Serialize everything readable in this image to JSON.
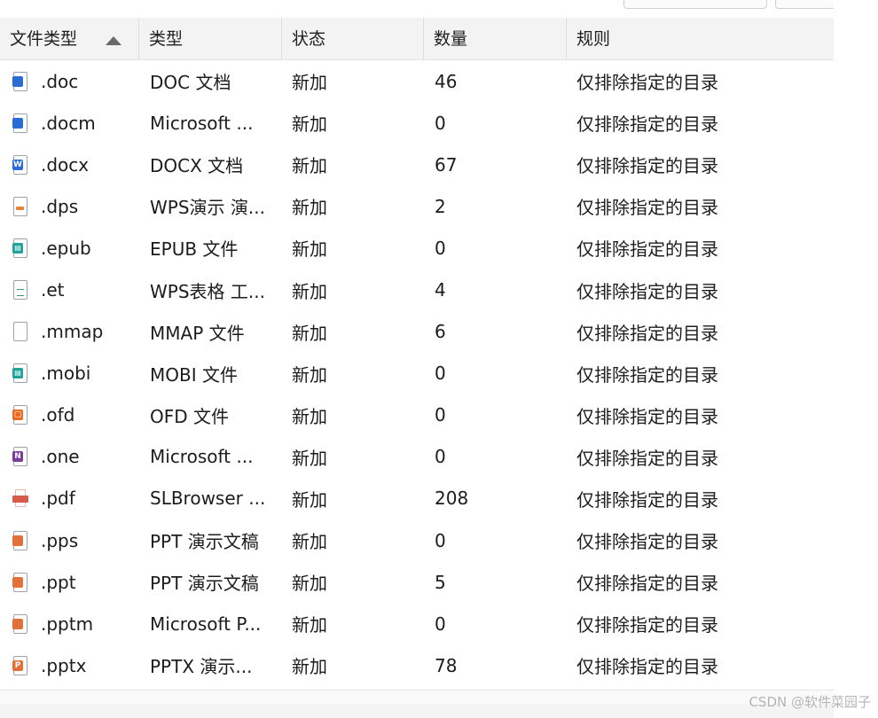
{
  "table": {
    "columns": [
      "文件类型",
      "类型",
      "状态",
      "数量",
      "规则"
    ],
    "sort_column": 0,
    "rows": [
      {
        "ext": ".doc",
        "type": "DOC 文档",
        "status": "新加",
        "count": "46",
        "rule": "仅排除指定的目录",
        "icon": "word-doc-icon",
        "color": "#2b6cd4"
      },
      {
        "ext": ".docm",
        "type": "Microsoft ...",
        "status": "新加",
        "count": "0",
        "rule": "仅排除指定的目录",
        "icon": "word-docm-icon",
        "color": "#2b6cd4"
      },
      {
        "ext": ".docx",
        "type": "DOCX 文档",
        "status": "新加",
        "count": "67",
        "rule": "仅排除指定的目录",
        "icon": "word-docx-icon",
        "color": "#2b6cd4"
      },
      {
        "ext": ".dps",
        "type": "WPS演示 演...",
        "status": "新加",
        "count": "2",
        "rule": "仅排除指定的目录",
        "icon": "wps-dps-icon",
        "color": "#e6843a"
      },
      {
        "ext": ".epub",
        "type": "EPUB 文件",
        "status": "新加",
        "count": "0",
        "rule": "仅排除指定的目录",
        "icon": "epub-book-icon",
        "color": "#1fa39a"
      },
      {
        "ext": ".et",
        "type": "WPS表格 工...",
        "status": "新加",
        "count": "4",
        "rule": "仅排除指定的目录",
        "icon": "wps-et-icon",
        "color": "#3c9a6a"
      },
      {
        "ext": ".mmap",
        "type": "MMAP 文件",
        "status": "新加",
        "count": "6",
        "rule": "仅排除指定的目录",
        "icon": "blank-file-icon",
        "color": "#9aa3ad"
      },
      {
        "ext": ".mobi",
        "type": "MOBI 文件",
        "status": "新加",
        "count": "0",
        "rule": "仅排除指定的目录",
        "icon": "mobi-book-icon",
        "color": "#1fa39a"
      },
      {
        "ext": ".ofd",
        "type": "OFD 文件",
        "status": "新加",
        "count": "0",
        "rule": "仅排除指定的目录",
        "icon": "ofd-file-icon",
        "color": "#ec6a1f"
      },
      {
        "ext": ".one",
        "type": "Microsoft ...",
        "status": "新加",
        "count": "0",
        "rule": "仅排除指定的目录",
        "icon": "onenote-icon",
        "color": "#7a3b9c"
      },
      {
        "ext": ".pdf",
        "type": "SLBrowser ...",
        "status": "新加",
        "count": "208",
        "rule": "仅排除指定的目录",
        "icon": "pdf-file-icon",
        "color": "#d65b4a"
      },
      {
        "ext": ".pps",
        "type": "PPT 演示文稿",
        "status": "新加",
        "count": "0",
        "rule": "仅排除指定的目录",
        "icon": "ppt-pps-icon",
        "color": "#e2703a"
      },
      {
        "ext": ".ppt",
        "type": "PPT 演示文稿",
        "status": "新加",
        "count": "5",
        "rule": "仅排除指定的目录",
        "icon": "ppt-file-icon",
        "color": "#e2703a"
      },
      {
        "ext": ".pptm",
        "type": "Microsoft P...",
        "status": "新加",
        "count": "0",
        "rule": "仅排除指定的目录",
        "icon": "pptm-file-icon",
        "color": "#e2703a"
      },
      {
        "ext": ".pptx",
        "type": "PPTX 演示...",
        "status": "新加",
        "count": "78",
        "rule": "仅排除指定的目录",
        "icon": "pptx-file-icon",
        "color": "#e2703a"
      }
    ]
  },
  "watermark": "CSDN @软件菜园子"
}
